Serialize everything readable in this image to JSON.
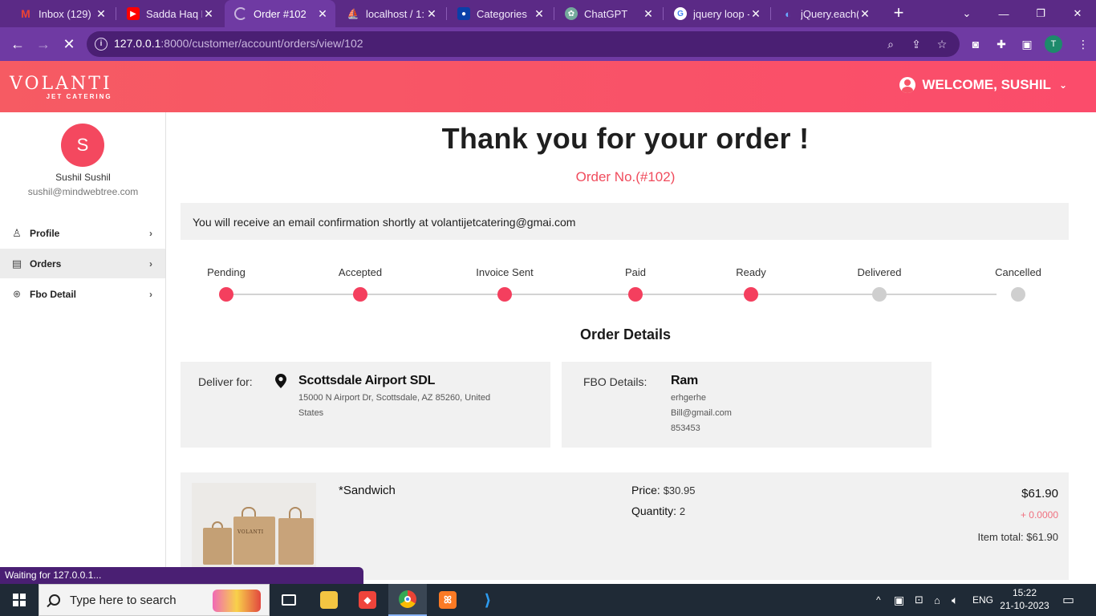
{
  "browser": {
    "tabs": [
      {
        "title": "Inbox (129) -",
        "favicon": "gmail-icon",
        "color": "#ea4335"
      },
      {
        "title": "Sadda Haq F",
        "favicon": "youtube-icon",
        "color": "#ff0000"
      },
      {
        "title": "Order #102",
        "favicon": "loading-icon",
        "color": "#6f3aa3"
      },
      {
        "title": "localhost / 1:",
        "favicon": "phpmyadmin-icon",
        "color": "#f29111"
      },
      {
        "title": "Categories",
        "favicon": "user-icon",
        "color": "#0a3fa8"
      },
      {
        "title": "ChatGPT",
        "favicon": "chatgpt-icon",
        "color": "#74aa9c"
      },
      {
        "title": "jquery loop -",
        "favicon": "google-icon",
        "color": "#ffffff"
      },
      {
        "title": "jQuery.each(",
        "favicon": "jquery-icon",
        "color": "#0769ad"
      }
    ],
    "url_host": "127.0.0.1",
    "url_path": ":8000/customer/account/orders/view/102",
    "profile_initial": "T",
    "status_text": "Waiting for 127.0.0.1..."
  },
  "header": {
    "logo_main": "VOLANTI",
    "logo_sub": "JET CATERING",
    "welcome": "WELCOME, SUSHIL"
  },
  "sidebar": {
    "avatar_initial": "S",
    "name": "Sushil Sushil",
    "email": "sushil@mindwebtree.com",
    "items": [
      {
        "label": "Profile",
        "icon": "user-icon"
      },
      {
        "label": "Orders",
        "icon": "document-icon"
      },
      {
        "label": "Fbo Detail",
        "icon": "location-pin-icon"
      }
    ]
  },
  "main": {
    "title": "Thank you for your order !",
    "order_no": "Order No.(#102)",
    "email_notice": "You will receive an email confirmation shortly at volantijetcatering@gmai.com",
    "steps": [
      {
        "label": "Pending",
        "done": true
      },
      {
        "label": "Accepted",
        "done": true
      },
      {
        "label": "Invoice Sent",
        "done": true
      },
      {
        "label": "Paid",
        "done": true
      },
      {
        "label": "Ready",
        "done": true
      },
      {
        "label": "Delivered",
        "done": false
      },
      {
        "label": "Cancelled",
        "done": false
      }
    ],
    "details_title": "Order Details",
    "deliver": {
      "label": "Deliver for:",
      "name": "Scottsdale Airport SDL",
      "address_line1": "15000 N Airport Dr, Scottsdale, AZ 85260, United",
      "address_line2": "States"
    },
    "fbo": {
      "label": "FBO Details:",
      "name": "Ram",
      "line1": "erhgerhe",
      "line2": "Bill@gmail.com",
      "line3": "853453"
    },
    "item": {
      "name": "*Sandwich",
      "price_label": "Price:",
      "price": "$30.95",
      "qty_label": "Quantity:",
      "qty": "2",
      "total": "$61.90",
      "extra": "+ 0.0000",
      "item_total_label": "Item total: $61.90",
      "image_logo": "VOLANTI"
    }
  },
  "taskbar": {
    "search_placeholder": "Type here to search",
    "lang": "ENG",
    "time": "15:22",
    "date": "21-10-2023"
  },
  "colors": {
    "accent": "#f43f5e",
    "chrome_purple": "#6f3aa3",
    "header_gradient_start": "#f65b63",
    "header_gradient_end": "#fb4c6b"
  }
}
